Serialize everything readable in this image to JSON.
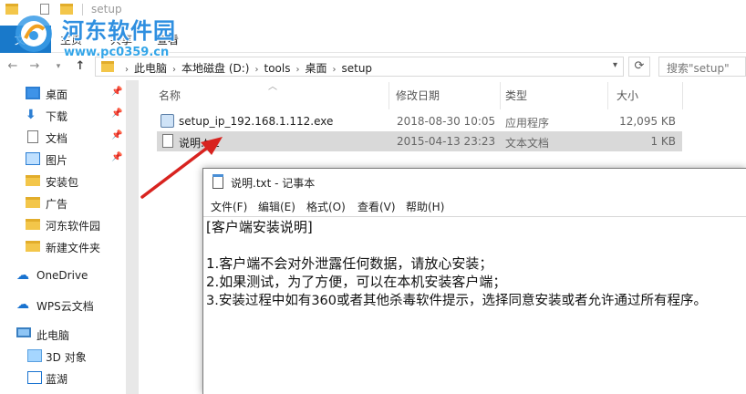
{
  "window": {
    "title": "setup"
  },
  "ribbon": {
    "tabs": [
      "文件",
      "主页",
      "共享",
      "查看"
    ]
  },
  "watermark": {
    "title": "河东软件园",
    "url": "www.pc0359.cn"
  },
  "address": {
    "crumbs": [
      "此电脑",
      "本地磁盘 (D:)",
      "tools",
      "桌面",
      "setup"
    ],
    "search_placeholder": "搜索\"setup\""
  },
  "nav": {
    "items": [
      {
        "label": "桌面",
        "icon": "desktop-icon",
        "pinned": true
      },
      {
        "label": "下载",
        "icon": "download-icon",
        "pinned": true
      },
      {
        "label": "文档",
        "icon": "documents-icon",
        "pinned": true
      },
      {
        "label": "图片",
        "icon": "pictures-icon",
        "pinned": true
      },
      {
        "label": "安装包",
        "icon": "folder-icon",
        "pinned": false
      },
      {
        "label": "广告",
        "icon": "folder-icon",
        "pinned": false
      },
      {
        "label": "河东软件园",
        "icon": "folder-icon",
        "pinned": false
      },
      {
        "label": "新建文件夹",
        "icon": "folder-icon",
        "pinned": false
      },
      {
        "label": "OneDrive",
        "icon": "onedrive-icon",
        "pinned": false
      },
      {
        "label": "WPS云文档",
        "icon": "wps-cloud-icon",
        "pinned": false
      },
      {
        "label": "此电脑",
        "icon": "this-pc-icon",
        "pinned": false
      },
      {
        "label": "3D 对象",
        "icon": "3d-objects-icon",
        "pinned": false
      },
      {
        "label": "蓝湖",
        "icon": "lanhu-icon",
        "pinned": false
      }
    ]
  },
  "files": {
    "columns": {
      "name": "名称",
      "date": "修改日期",
      "type": "类型",
      "size": "大小"
    },
    "rows": [
      {
        "name": "setup_ip_192.168.1.112.exe",
        "date": "2018-08-30 10:05",
        "type": "应用程序",
        "size": "12,095 KB"
      },
      {
        "name": "说明.txt",
        "date": "2015-04-13 23:23",
        "type": "文本文档",
        "size": "1 KB"
      }
    ]
  },
  "notepad": {
    "title": "说明.txt - 记事本",
    "menu": [
      "文件(F)",
      "编辑(E)",
      "格式(O)",
      "查看(V)",
      "帮助(H)"
    ],
    "lines": [
      "[客户端安装说明]",
      "",
      "1.客户端不会对外泄露任何数据，请放心安装；",
      "2.如果测试，为了方便，可以在本机安装客户端；",
      "3.安装过程中如有360或者其他杀毒软件提示，选择同意安装或者允许通过所有程序。"
    ]
  },
  "colors": {
    "accent": "#1979ca",
    "watermark": "#2f8fe0",
    "arrow": "#d8231f",
    "selection": "#d9d9d9"
  }
}
